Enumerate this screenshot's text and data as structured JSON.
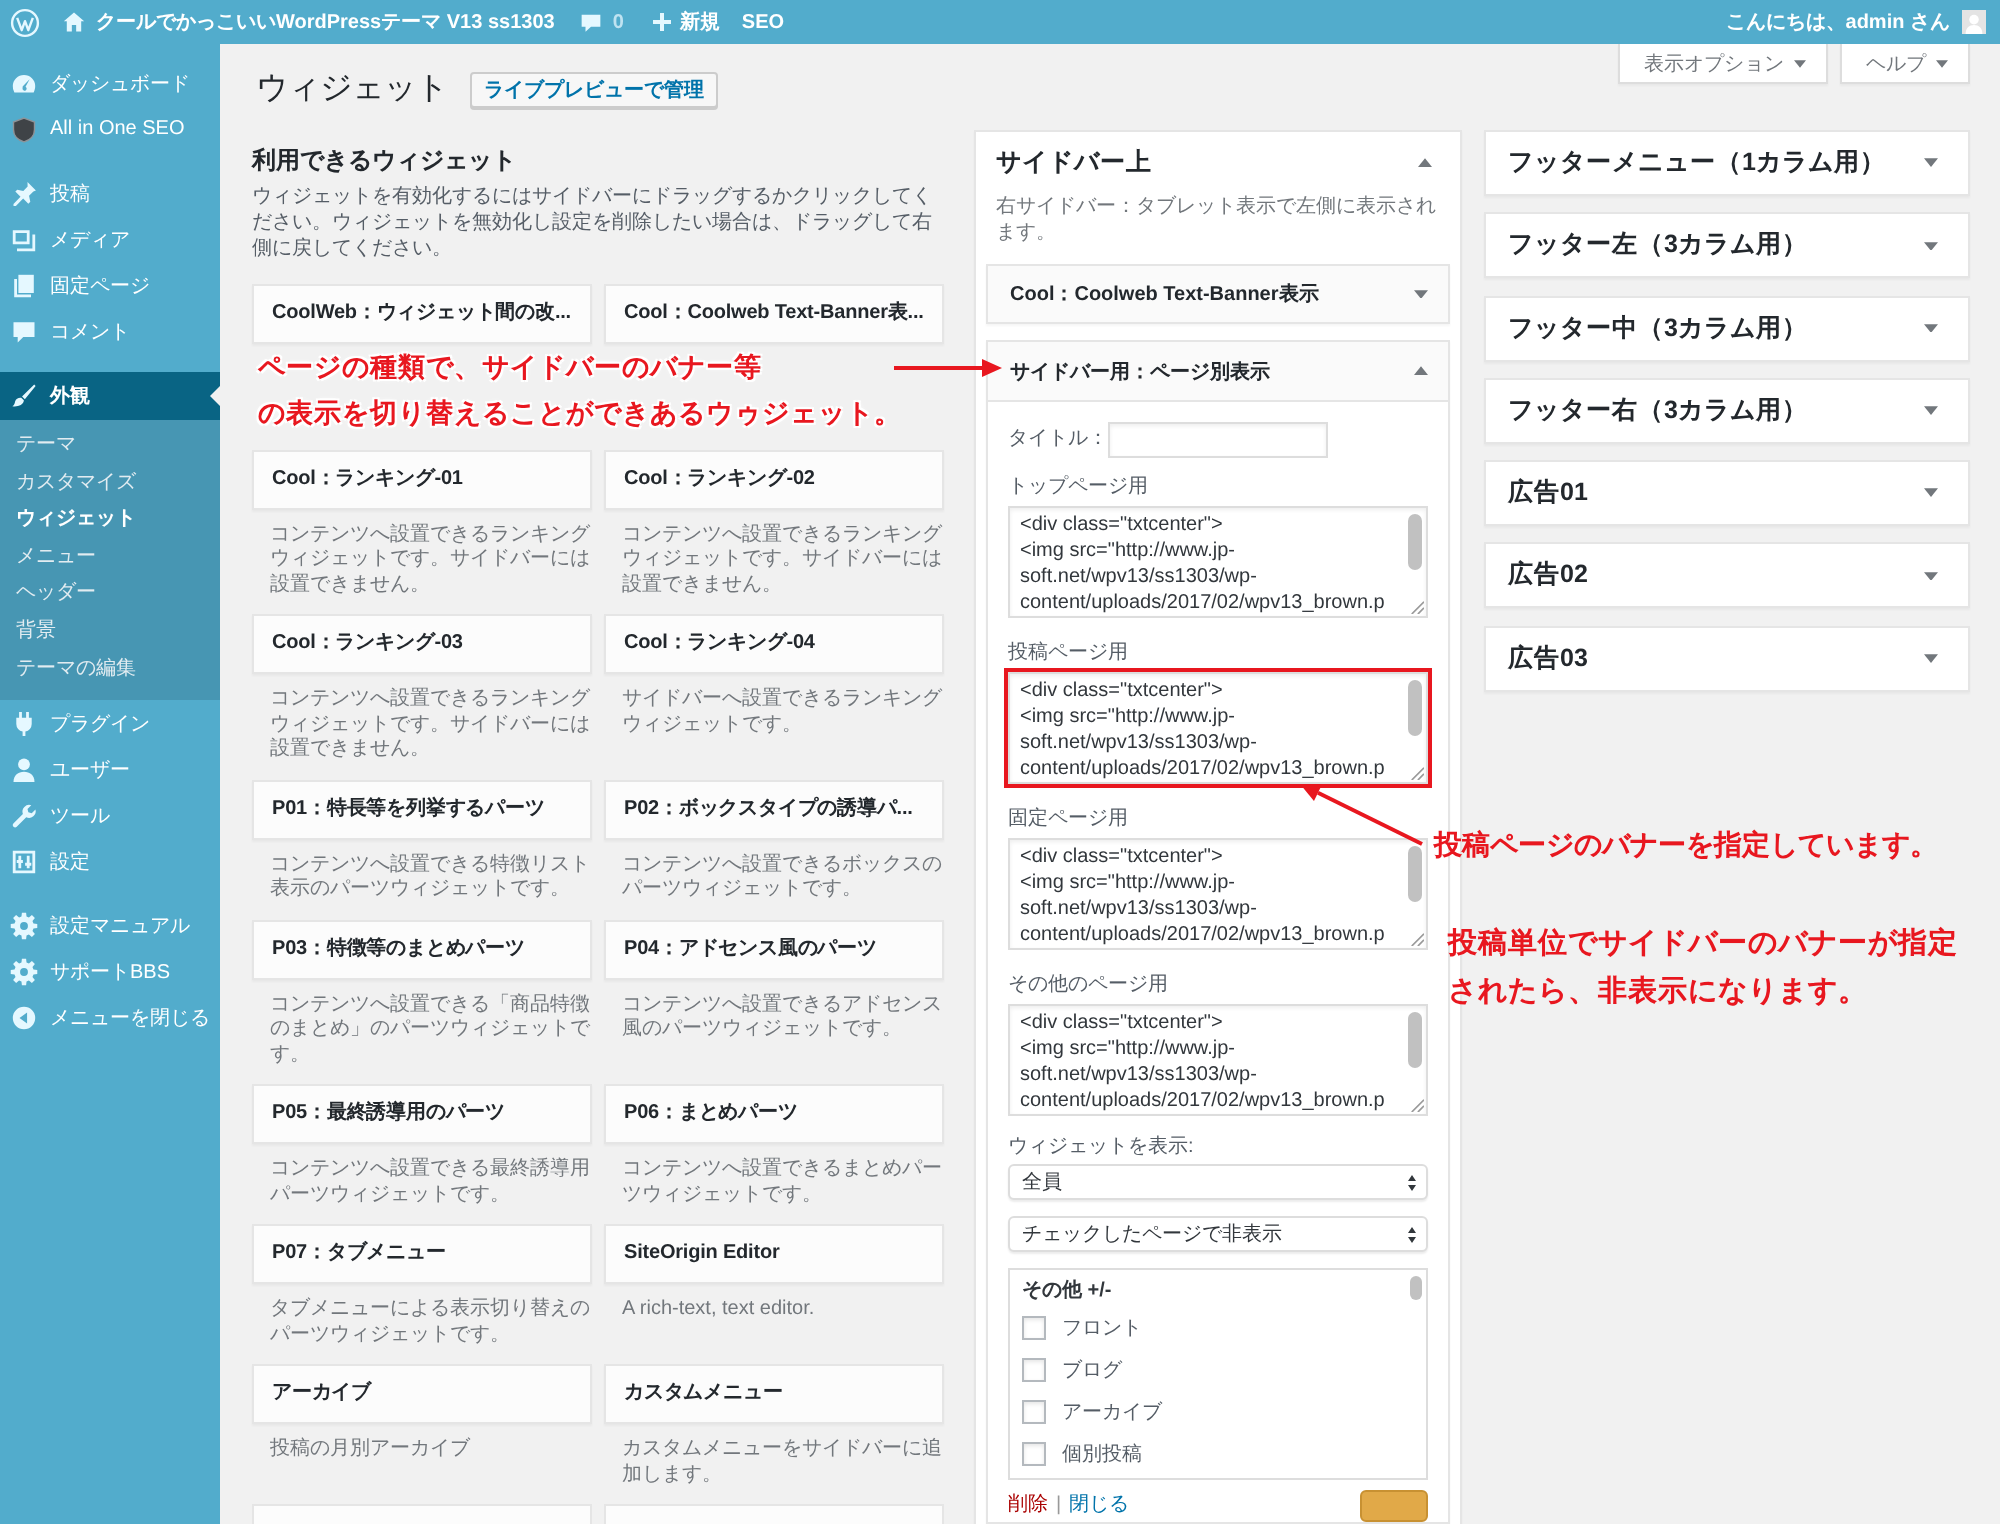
{
  "admin_bar": {
    "site_name": "クールでかっこいいWordPressテーマ V13 ss1303",
    "comment_count": "0",
    "new_label": "新規",
    "seo_label": "SEO",
    "greeting": "こんにちは、admin さん"
  },
  "sidebar": {
    "groups": [
      {
        "items": [
          {
            "label": "ダッシュボード",
            "selected": false
          },
          {
            "label": "All in One SEO",
            "selected": false
          }
        ]
      },
      {
        "items": [
          {
            "label": "投稿",
            "selected": false
          },
          {
            "label": "メディア",
            "selected": false
          },
          {
            "label": "固定ページ",
            "selected": false
          },
          {
            "label": "コメント",
            "selected": false
          }
        ]
      },
      {
        "items": [
          {
            "label": "外観",
            "selected": true,
            "children": [
              {
                "label": "テーマ",
                "selected": false
              },
              {
                "label": "カスタマイズ",
                "selected": false
              },
              {
                "label": "ウィジェット",
                "selected": true
              },
              {
                "label": "メニュー",
                "selected": false
              },
              {
                "label": "ヘッダー",
                "selected": false
              },
              {
                "label": "背景",
                "selected": false
              },
              {
                "label": "テーマの編集",
                "selected": false
              }
            ]
          },
          {
            "label": "プラグイン",
            "selected": false
          },
          {
            "label": "ユーザー",
            "selected": false
          },
          {
            "label": "ツール",
            "selected": false
          },
          {
            "label": "設定",
            "selected": false
          }
        ]
      },
      {
        "items": [
          {
            "label": "設定マニュアル",
            "selected": false
          },
          {
            "label": "サポートBBS",
            "selected": false
          },
          {
            "label": "メニューを閉じる",
            "selected": false
          }
        ]
      }
    ]
  },
  "screen_buttons": [
    {
      "label": "表示オプション"
    },
    {
      "label": "ヘルプ"
    }
  ],
  "page_title": "ウィジェット",
  "live_preview_button": "ライブプレビューで管理",
  "available": {
    "heading": "利用できるウィジェット",
    "description": "ウィジェットを有効化するにはサイドバーにドラッグするかクリックしてください。ウィジェットを無効化し設定を削除したい場合は、ドラッグして右側に戻してください。",
    "widgets": [
      {
        "kind": "widget",
        "title": "CoolWeb：ウィジェット間の改..."
      },
      {
        "kind": "widget",
        "title": "Cool：Coolweb Text-Banner表..."
      },
      {
        "kind": "widget",
        "title": "Cool：ランキング-01",
        "description": "コンテンツへ設置できるランキングウィジェットです。サイドバーには設置できません。"
      },
      {
        "kind": "widget",
        "title": "Cool：ランキング-02",
        "description": "コンテンツへ設置できるランキングウィジェットです。サイドバーには設置できません。"
      },
      {
        "kind": "widget",
        "title": "Cool：ランキング-03",
        "description": "コンテンツへ設置できるランキングウィジェットです。サイドバーには設置できません。"
      },
      {
        "kind": "widget",
        "title": "Cool：ランキング-04",
        "description": "サイドバーへ設置できるランキングウィジェットです。"
      },
      {
        "kind": "widget",
        "title": "P01：特長等を列挙するパーツ",
        "description": "コンテンツへ設置できる特徴リスト表示のパーツウィジェットです。"
      },
      {
        "kind": "widget",
        "title": "P02：ボックスタイプの誘導パ...",
        "description": "コンテンツへ設置できるボックスのパーツウィジェットです。"
      },
      {
        "kind": "widget",
        "title": "P03：特徴等のまとめパーツ",
        "description": "コンテンツへ設置できる「商品特徴のまとめ」のパーツウィジェットです。"
      },
      {
        "kind": "widget",
        "title": "P04：アドセンス風のパーツ",
        "description": "コンテンツへ設置できるアドセンス風のパーツウィジェットです。"
      },
      {
        "kind": "widget",
        "title": "P05：最終誘導用のパーツ",
        "description": "コンテンツへ設置できる最終誘導用パーツウィジェットです。"
      },
      {
        "kind": "widget",
        "title": "P06：まとめパーツ",
        "description": "コンテンツへ設置できるまとめパーツウィジェットです。"
      },
      {
        "kind": "widget",
        "title": "P07：タブメニュー",
        "description": "タブメニューによる表示切り替えのパーツウィジェットです。"
      },
      {
        "kind": "widget",
        "title": "SiteOrigin Editor",
        "description": "A rich-text, text editor."
      },
      {
        "kind": "widget",
        "title": "アーカイブ",
        "description": "投稿の月別アーカイブ"
      },
      {
        "kind": "widget",
        "title": "カスタムメニュー",
        "description": "カスタムメニューをサイドバーに追加します。"
      },
      {
        "kind": "cut"
      },
      {
        "kind": "cut"
      }
    ]
  },
  "widget_areas": [
    {
      "title": "サイドバー上",
      "expanded": true,
      "description": "右サイドバー：タブレット表示で左側に表示されます。",
      "widgets": [
        {
          "title": "Cool：Coolweb Text-Banner表示",
          "expanded": false
        },
        {
          "title": "サイドバー用：ページ別表示",
          "expanded": true,
          "form": {
            "title_label": "タイトル：",
            "text_fields": [
              {
                "label": "トップページ用",
                "value": "<div class=\"txtcenter\">\n<img src=\"http://www.jp-\nsoft.net/wpv13/ss1303/wp-\ncontent/uploads/2017/02/wpv13_brown.p",
                "highlighted": false
              },
              {
                "label": "投稿ページ用",
                "value": "<div class=\"txtcenter\">\n<img src=\"http://www.jp-\nsoft.net/wpv13/ss1303/wp-\ncontent/uploads/2017/02/wpv13_brown.p",
                "highlighted": true
              },
              {
                "label": "固定ページ用",
                "value": "<div class=\"txtcenter\">\n<img src=\"http://www.jp-\nsoft.net/wpv13/ss1303/wp-\ncontent/uploads/2017/02/wpv13_brown.p",
                "highlighted": false
              },
              {
                "label": "その他のページ用",
                "value": "<div class=\"txtcenter\">\n<img src=\"http://www.jp-\nsoft.net/wpv13/ss1303/wp-\ncontent/uploads/2017/02/wpv13_brown.p",
                "highlighted": false
              }
            ],
            "visibility_label": "ウィジェットを表示:",
            "selects": [
              {
                "value": "全員"
              },
              {
                "value": "チェックしたページで非表示"
              }
            ],
            "page_list": {
              "heading": "その他 +/-",
              "options": [
                {
                  "label": "フロント",
                  "checked": false
                },
                {
                  "label": "ブログ",
                  "checked": false
                },
                {
                  "label": "アーカイブ",
                  "checked": false
                },
                {
                  "label": "個別投稿",
                  "checked": false
                }
              ]
            },
            "delete_link": "削除",
            "link_separator": "|",
            "close_link": "閉じる",
            "primary_button": true
          }
        }
      ]
    },
    {
      "title": "フッターメニュー（1カラム用）",
      "expanded": false
    },
    {
      "title": "フッター左（3カラム用）",
      "expanded": false
    },
    {
      "title": "フッター中（3カラム用）",
      "expanded": false
    },
    {
      "title": "フッター右（3カラム用）",
      "expanded": false
    },
    {
      "title": "広告01",
      "expanded": false
    },
    {
      "title": "広告02",
      "expanded": false
    },
    {
      "title": "広告03",
      "expanded": false
    }
  ],
  "annotations": [
    {
      "lines": [
        "ページの種類で、サイドバーのバナー等",
        "の表示を切り替えることができあるウゥジェット。"
      ],
      "arrow": true
    },
    {
      "lines": [
        "投稿ページのバナーを指定しています。"
      ],
      "arrow": true
    },
    {
      "lines": [
        "投稿単位でサイドバーのバナーが指定",
        "されたら、非表示になります。"
      ],
      "arrow": false
    }
  ]
}
